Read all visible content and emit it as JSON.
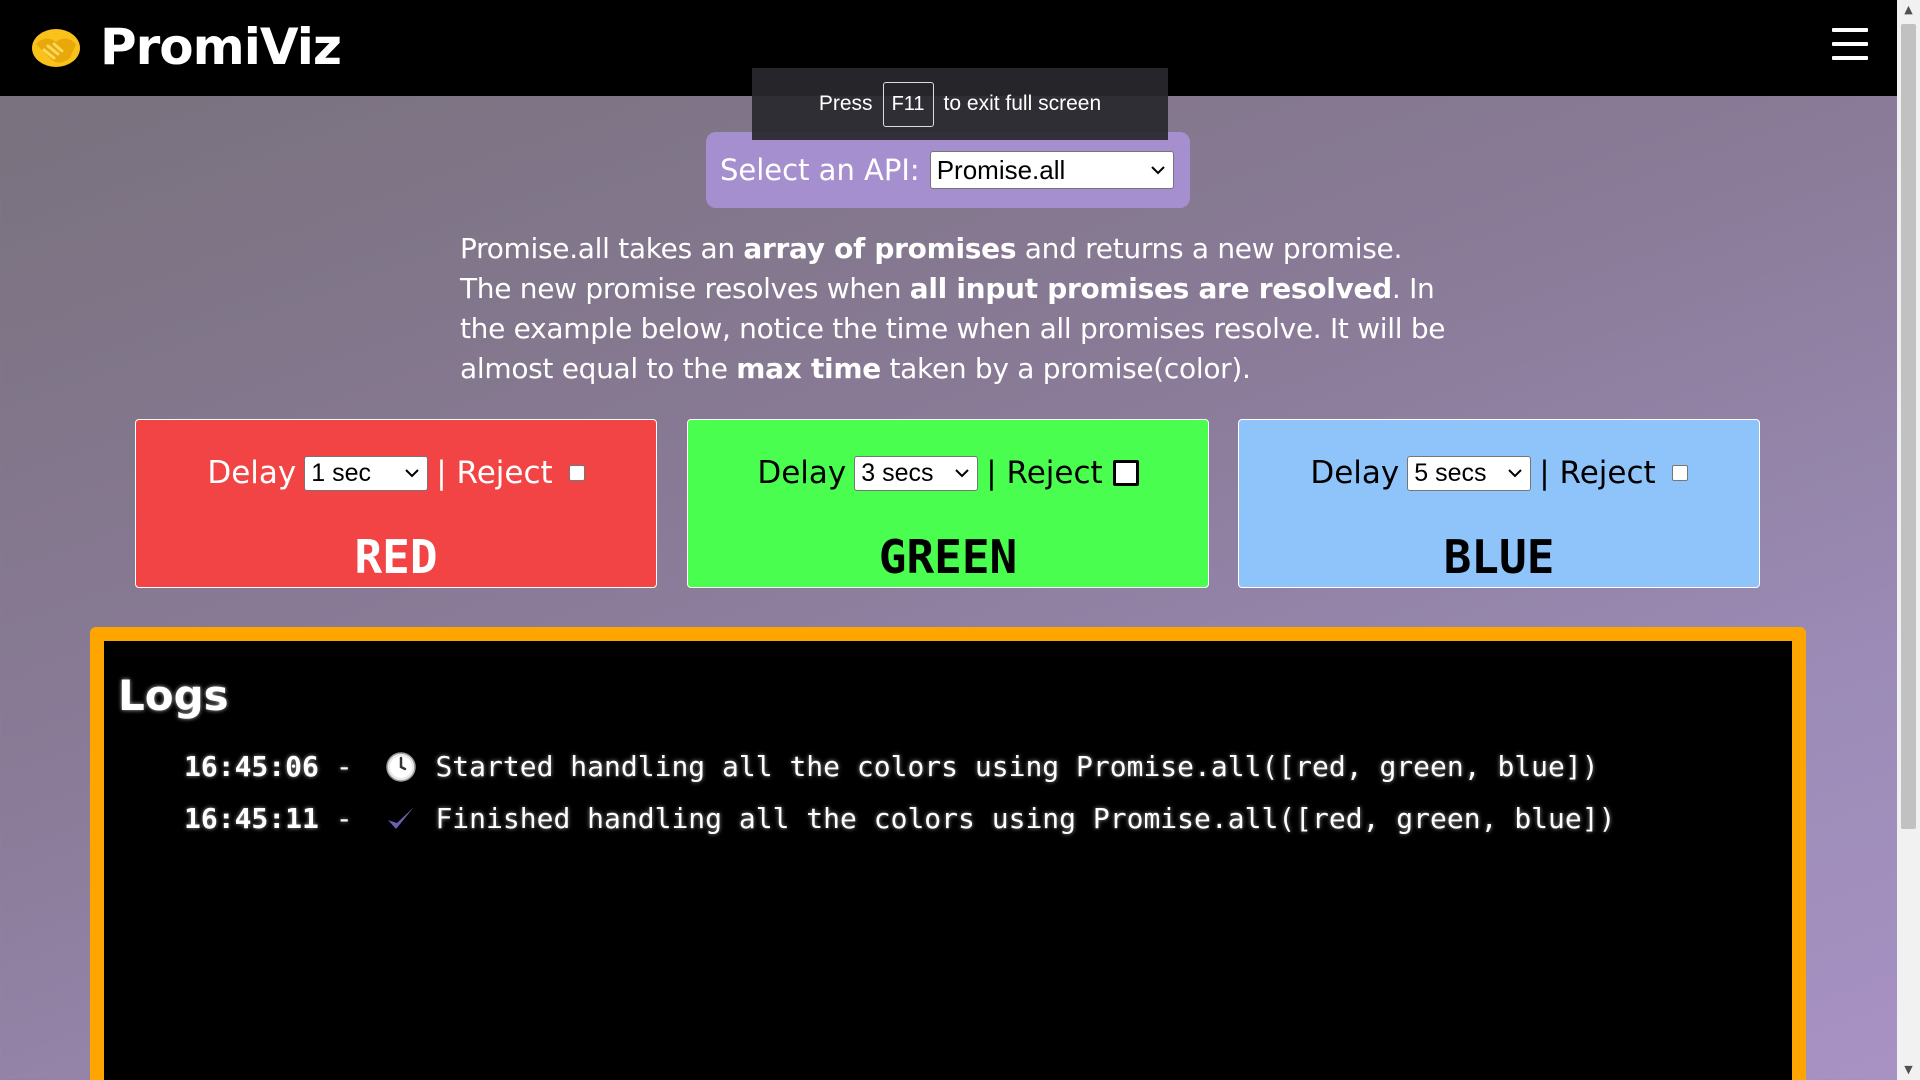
{
  "header": {
    "brand": "PromiViz",
    "logo_icon": "handshake-icon",
    "menu_icon": "hamburger-icon"
  },
  "fullscreen_toast": {
    "before": "Press",
    "key": "F11",
    "after": "to exit full screen"
  },
  "api": {
    "label": "Select an API:",
    "selected": "Promise.all"
  },
  "description": {
    "p1": "Promise.all takes an ",
    "b1": "array of promises",
    "p2": " and returns a new promise. The new promise resolves when ",
    "b2": "all input promises are resolved",
    "p3": ". In the example below, notice the time when all promises resolve. It will be almost equal to the ",
    "b3": "max time",
    "p4": " taken by a promise(color)."
  },
  "cards": [
    {
      "name": "RED",
      "delay_label": "Delay",
      "delay": "1 sec",
      "reject_label": "| Reject",
      "reject": false,
      "color": "#f24444"
    },
    {
      "name": "GREEN",
      "delay_label": "Delay",
      "delay": "3 secs",
      "reject_label": "| Reject",
      "reject": false,
      "color": "#4afe4f"
    },
    {
      "name": "BLUE",
      "delay_label": "Delay",
      "delay": "5 secs",
      "reject_label": "| Reject",
      "reject": false,
      "color": "#8fc4fa"
    }
  ],
  "logs": {
    "title": "Logs",
    "border_color": "#ffa500",
    "entries": [
      {
        "time": "16:45:06",
        "sep": " - ",
        "icon": "clock-icon",
        "message": "Started handling all the colors using Promise.all([red, green, blue])"
      },
      {
        "time": "16:45:11",
        "sep": " - ",
        "icon": "checkmark-icon",
        "message": "Finished handling all the colors using Promise.all([red, green, blue])"
      }
    ]
  }
}
